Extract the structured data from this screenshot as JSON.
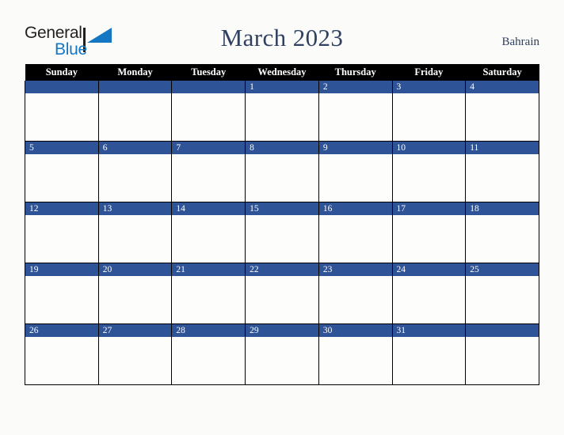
{
  "branding": {
    "logo_text_primary": "General",
    "logo_text_secondary": "Blue",
    "logo_triangle_icon": "triangle-icon",
    "primary_color": "#1577c4",
    "text_color": "#231f20"
  },
  "header": {
    "title": "March 2023",
    "country": "Bahrain",
    "title_color": "#2f4061"
  },
  "calendar": {
    "month": "March",
    "year": "2023",
    "header_background": "#000000",
    "header_text_color": "#ffffff",
    "date_bar_color": "#2e5396",
    "cell_background": "#fdfdfc",
    "weekdays": [
      "Sunday",
      "Monday",
      "Tuesday",
      "Wednesday",
      "Thursday",
      "Friday",
      "Saturday"
    ],
    "weeks": [
      [
        "",
        "",
        "",
        "1",
        "2",
        "3",
        "4"
      ],
      [
        "5",
        "6",
        "7",
        "8",
        "9",
        "10",
        "11"
      ],
      [
        "12",
        "13",
        "14",
        "15",
        "16",
        "17",
        "18"
      ],
      [
        "19",
        "20",
        "21",
        "22",
        "23",
        "24",
        "25"
      ],
      [
        "26",
        "27",
        "28",
        "29",
        "30",
        "31",
        ""
      ]
    ]
  }
}
